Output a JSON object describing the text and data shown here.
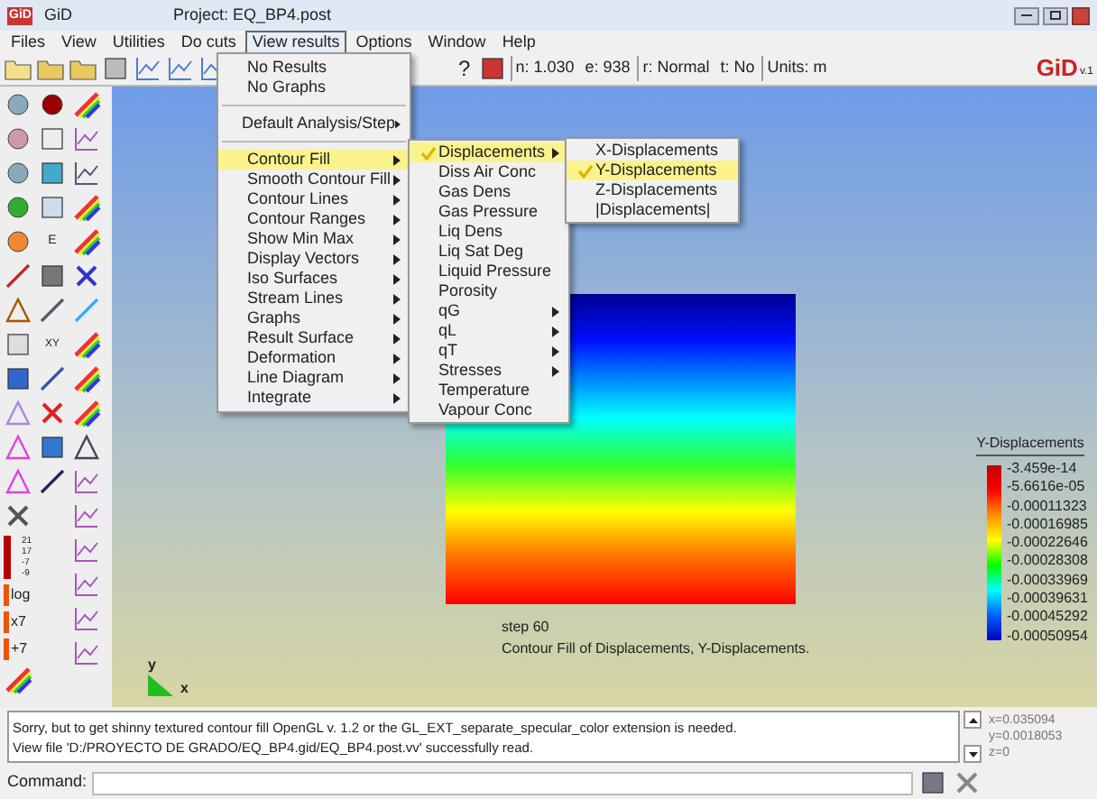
{
  "window": {
    "logo": "GiD",
    "app": "GiD",
    "title": "Project: EQ_BP4.post"
  },
  "menubar": [
    {
      "label": "Files",
      "selected": false
    },
    {
      "label": "View",
      "selected": false
    },
    {
      "label": "Utilities",
      "selected": false
    },
    {
      "label": "Do cuts",
      "selected": false
    },
    {
      "label": "View results",
      "selected": true
    },
    {
      "label": "Options",
      "selected": false
    },
    {
      "label": "Window",
      "selected": false
    },
    {
      "label": "Help",
      "selected": false
    }
  ],
  "toolbar": {
    "help": "?",
    "info": [
      "n: 1.030",
      "e: 938",
      "r: Normal",
      "t: No",
      "Units: m"
    ],
    "logo": "GiD",
    "version": "v.1"
  },
  "left_toolbar": {
    "scale_labels": [
      "21",
      "17",
      "-7",
      "-9"
    ],
    "legend_labels": [
      "log",
      "x7",
      "+7"
    ],
    "axis_label": "XY",
    "list_label": "E"
  },
  "view_results_menu": [
    {
      "kind": "item",
      "label": "No Results",
      "has_submenu": false,
      "selected": false
    },
    {
      "kind": "item",
      "label": "No Graphs",
      "has_submenu": false,
      "selected": false
    },
    {
      "kind": "separator"
    },
    {
      "kind": "item",
      "label": "Default Analysis/Step",
      "has_submenu": true,
      "selected": false
    },
    {
      "kind": "separator"
    },
    {
      "kind": "item",
      "label": "Contour Fill",
      "has_submenu": true,
      "selected": true
    },
    {
      "kind": "item",
      "label": "Smooth Contour Fill",
      "has_submenu": true,
      "selected": false
    },
    {
      "kind": "item",
      "label": "Contour Lines",
      "has_submenu": true,
      "selected": false
    },
    {
      "kind": "item",
      "label": "Contour Ranges",
      "has_submenu": true,
      "selected": false
    },
    {
      "kind": "item",
      "label": "Show Min Max",
      "has_submenu": true,
      "selected": false
    },
    {
      "kind": "item",
      "label": "Display Vectors",
      "has_submenu": true,
      "selected": false
    },
    {
      "kind": "item",
      "label": "Iso Surfaces",
      "has_submenu": true,
      "selected": false
    },
    {
      "kind": "item",
      "label": "Stream Lines",
      "has_submenu": true,
      "selected": false
    },
    {
      "kind": "item",
      "label": "Graphs",
      "has_submenu": true,
      "selected": false
    },
    {
      "kind": "item",
      "label": "Result Surface",
      "has_submenu": true,
      "selected": false
    },
    {
      "kind": "item",
      "label": "Deformation",
      "has_submenu": true,
      "selected": false
    },
    {
      "kind": "item",
      "label": "Line Diagram",
      "has_submenu": true,
      "selected": false
    },
    {
      "kind": "item",
      "label": "Integrate",
      "has_submenu": true,
      "selected": false
    }
  ],
  "contour_fill_menu": [
    {
      "label": "Displacements",
      "checked": true,
      "has_submenu": true,
      "selected": true
    },
    {
      "label": "Diss Air Conc",
      "checked": false,
      "has_submenu": false,
      "selected": false
    },
    {
      "label": "Gas Dens",
      "checked": false,
      "has_submenu": false,
      "selected": false
    },
    {
      "label": "Gas Pressure",
      "checked": false,
      "has_submenu": false,
      "selected": false
    },
    {
      "label": "Liq Dens",
      "checked": false,
      "has_submenu": false,
      "selected": false
    },
    {
      "label": "Liq Sat Deg",
      "checked": false,
      "has_submenu": false,
      "selected": false
    },
    {
      "label": "Liquid Pressure",
      "checked": false,
      "has_submenu": false,
      "selected": false
    },
    {
      "label": "Porosity",
      "checked": false,
      "has_submenu": false,
      "selected": false
    },
    {
      "label": "qG",
      "checked": false,
      "has_submenu": true,
      "selected": false
    },
    {
      "label": "qL",
      "checked": false,
      "has_submenu": true,
      "selected": false
    },
    {
      "label": "qT",
      "checked": false,
      "has_submenu": true,
      "selected": false
    },
    {
      "label": "Stresses",
      "checked": false,
      "has_submenu": true,
      "selected": false
    },
    {
      "label": "Temperature",
      "checked": false,
      "has_submenu": false,
      "selected": false
    },
    {
      "label": "Vapour Conc",
      "checked": false,
      "has_submenu": false,
      "selected": false
    }
  ],
  "displacements_menu": [
    {
      "label": "X-Displacements",
      "checked": false,
      "selected": false
    },
    {
      "label": "Y-Displacements",
      "checked": true,
      "selected": true
    },
    {
      "label": "Z-Displacements",
      "checked": false,
      "selected": false
    },
    {
      "label": "|Displacements|",
      "checked": false,
      "selected": false
    }
  ],
  "canvas": {
    "step": "step 60",
    "caption": "Contour Fill of Displacements, Y-Displacements.",
    "axis_y": "y",
    "axis_x": "x"
  },
  "legend": {
    "title": "Y-Displacements",
    "values": [
      "-3.459e-14",
      "-5.6616e-05",
      "-0.00011323",
      "-0.00016985",
      "-0.00022646",
      "-0.00028308",
      "-0.00033969",
      "-0.00039631",
      "-0.00045292",
      "-0.00050954"
    ]
  },
  "messages": [
    "Sorry, but to get shinny textured contour fill OpenGL v. 1.2 or the GL_EXT_separate_specular_color extension is needed.",
    "View file 'D:/PROYECTO DE GRADO/EQ_BP4.gid/EQ_BP4.post.vv' successfully read."
  ],
  "coordinates": [
    "x=0.035094",
    "y=0.0018053",
    "z=0"
  ],
  "command": {
    "label": "Command:"
  }
}
